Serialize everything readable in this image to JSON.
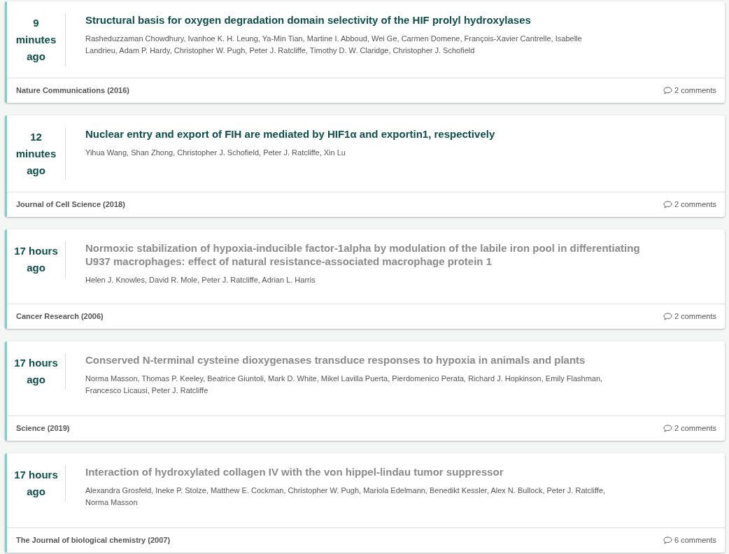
{
  "papers": [
    {
      "time": "9 minutes ago",
      "title": "Structural basis for oxygen degradation domain selectivity of the HIF prolyl hydroxylases",
      "visited": false,
      "authors": "Rasheduzzaman Chowdhury, Ivanhoe K. H. Leung, Ya-Min Tian, Martine I. Abboud, Wei Ge, Carmen Domene, François-Xavier Cantrelle, Isabelle Landrieu, Adam P. Hardy, Christopher W. Pugh, Peter J. Ratcliffe, Timothy D. W. Claridge, Christopher J. Schofield",
      "journal": "Nature Communications (2016)",
      "comments": "2 comments"
    },
    {
      "time": "12 minutes ago",
      "title": "Nuclear entry and export of FIH are mediated by HIF1α and exportin1, respectively",
      "visited": false,
      "authors": "Yihua Wang, Shan Zhong, Christopher J. Schofield, Peter J. Ratcliffe, Xin Lu",
      "journal": "Journal of Cell Science (2018)",
      "comments": "2 comments"
    },
    {
      "time": "17 hours ago",
      "title": "Normoxic stabilization of hypoxia-inducible factor-1alpha by modulation of the labile iron pool in differentiating U937 macrophages: effect of natural resistance-associated macrophage protein 1",
      "visited": true,
      "authors": "Helen J. Knowles, David R. Mole, Peter J. Ratcliffe, Adrian L. Harris",
      "journal": "Cancer Research (2006)",
      "comments": "2 comments"
    },
    {
      "time": "17 hours ago",
      "title": "Conserved N-terminal cysteine dioxygenases transduce responses to hypoxia in animals and plants",
      "visited": true,
      "authors": "Norma Masson, Thomas P. Keeley, Beatrice Giuntoli, Mark D. White, Mikel Lavilla Puerta, Pierdomenico Perata, Richard J. Hopkinson, Emily Flashman, Francesco Licausi, Peter J. Ratcliffe",
      "journal": "Science (2019)",
      "comments": "2 comments"
    },
    {
      "time": "17 hours ago",
      "title": "Interaction of hydroxylated collagen IV with the von hippel-lindau tumor suppressor",
      "visited": true,
      "authors": "Alexandra Grosfeld, Ineke P. Stolze, Matthew E. Cockman, Christopher W. Pugh, Mariola Edelmann, Benedikt Kessler, Alex N. Bullock, Peter J. Ratcliffe, Norma Masson",
      "journal": "The Journal of biological chemistry (2007)",
      "comments": "6 comments"
    }
  ]
}
